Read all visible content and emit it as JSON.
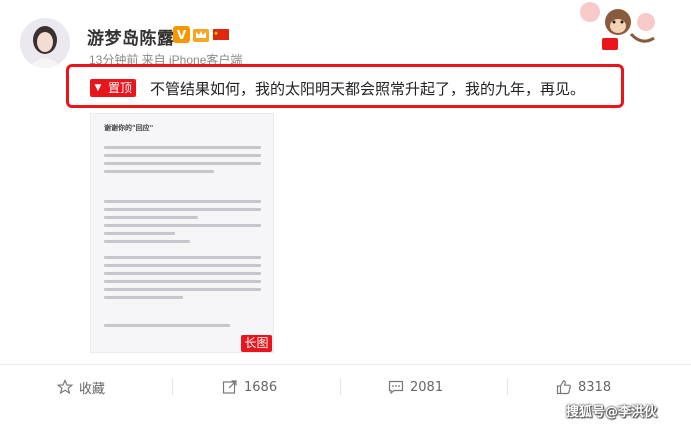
{
  "post": {
    "username": "游梦岛陈露",
    "meta": "13分钟前 来自 iPhone客户端",
    "pinned_label": "置顶",
    "text": "不管结果如何，我的太阳明天都会照常升起了，我的九年，再见。",
    "long_image_tag": "长图",
    "image_title": "谢谢你的\"回应\""
  },
  "actions": {
    "favorite_label": "收藏",
    "repost_count": "1686",
    "comment_count": "2081",
    "like_count": "8318"
  },
  "watermark": "搜狐号@李洪伙",
  "icons": {
    "verified": "verified-v-icon",
    "flag": "china-flag-icon"
  },
  "colors": {
    "highlight": "#e8151c",
    "verified": "#f39800"
  }
}
